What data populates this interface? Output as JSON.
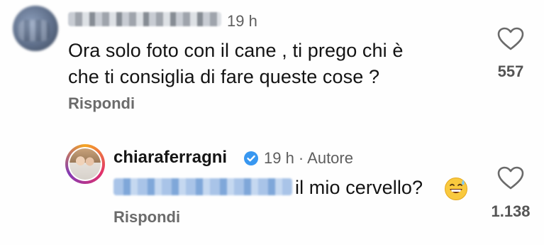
{
  "comment": {
    "time": "19 h",
    "text_line1": "Ora solo foto con il cane , ti prego chi è",
    "text_line2": "che ti consiglia di fare queste cose ?",
    "reply_label": "Rispondi",
    "likes": "557"
  },
  "reply": {
    "author": "chiaraferragni",
    "time_and_role": "19 h · Autore",
    "text": "il mio cervello?",
    "emoji": "grinning-sweat-emoji",
    "reply_label": "Rispondi",
    "likes": "1.138"
  },
  "colors": {
    "verified": "#3897f0",
    "text": "#131313",
    "muted": "#6b6b6b"
  }
}
